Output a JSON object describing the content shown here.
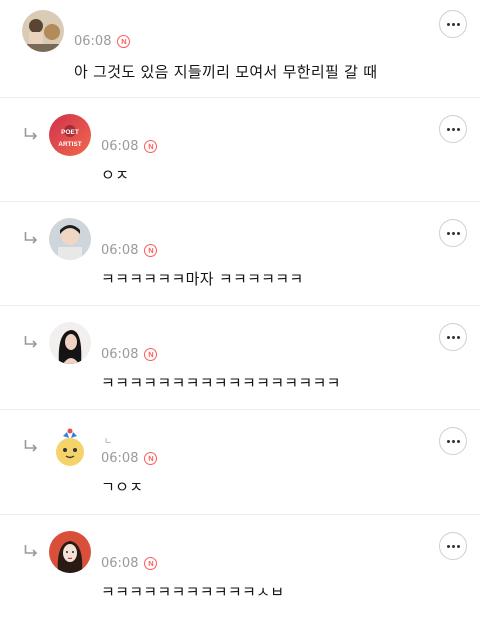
{
  "comments": [
    {
      "time": "06:08",
      "badge": "N",
      "text": "아 그것도 있음 지들끼리 모여서 무한리필 갈 때"
    },
    {
      "time": "06:08",
      "badge": "N",
      "text": "ㅇㅈ",
      "avatar_text_1": "POET",
      "avatar_text_2": "ARTIST"
    },
    {
      "time": "06:08",
      "badge": "N",
      "text": "ㅋㅋㅋㅋㅋㅋ마자 ㅋㅋㅋㅋㅋㅋ"
    },
    {
      "time": "06:08",
      "badge": "N",
      "text": "ㅋㅋㅋㅋㅋㅋㅋㅋㅋㅋㅋㅋㅋㅋㅋㅋㅋ"
    },
    {
      "time": "06:08",
      "badge": "N",
      "text": "ㄱㅇㅈ",
      "name_fragment": "ㄴ"
    },
    {
      "time": "06:08",
      "badge": "N",
      "text": "ㅋㅋㅋㅋㅋㅋㅋㅋㅋㅋㅋㅅㅂ"
    }
  ],
  "icons": {
    "reply": "reply-arrow-icon",
    "more": "more-options-icon",
    "new": "new-badge-icon"
  },
  "colors": {
    "badge": "#ff5a5a",
    "meta": "#9a9a9a",
    "divider": "#ececec"
  }
}
